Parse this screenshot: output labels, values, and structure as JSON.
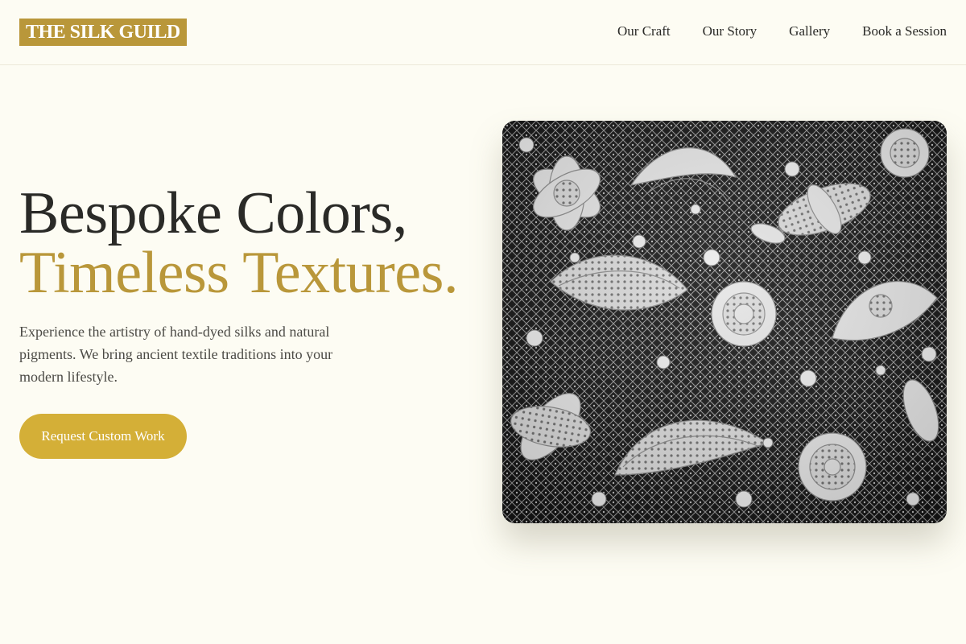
{
  "brand": {
    "name": "THE SILK GUILD"
  },
  "nav": {
    "items": [
      {
        "label": "Our Craft"
      },
      {
        "label": "Our Story"
      },
      {
        "label": "Gallery"
      },
      {
        "label": "Book a Session"
      }
    ]
  },
  "hero": {
    "title_line1": "Bespoke Colors,",
    "title_line2": "Timeless Textures.",
    "description": "Experience the artistry of hand-dyed silks and natural pigments. We bring ancient textile traditions into your modern lifestyle.",
    "cta_label": "Request Custom Work",
    "image_icon": "lace-fabric-photo"
  },
  "colors": {
    "background": "#fdfcf3",
    "accent": "#b9973a",
    "button": "#d4af37",
    "text": "#2a2a27"
  }
}
